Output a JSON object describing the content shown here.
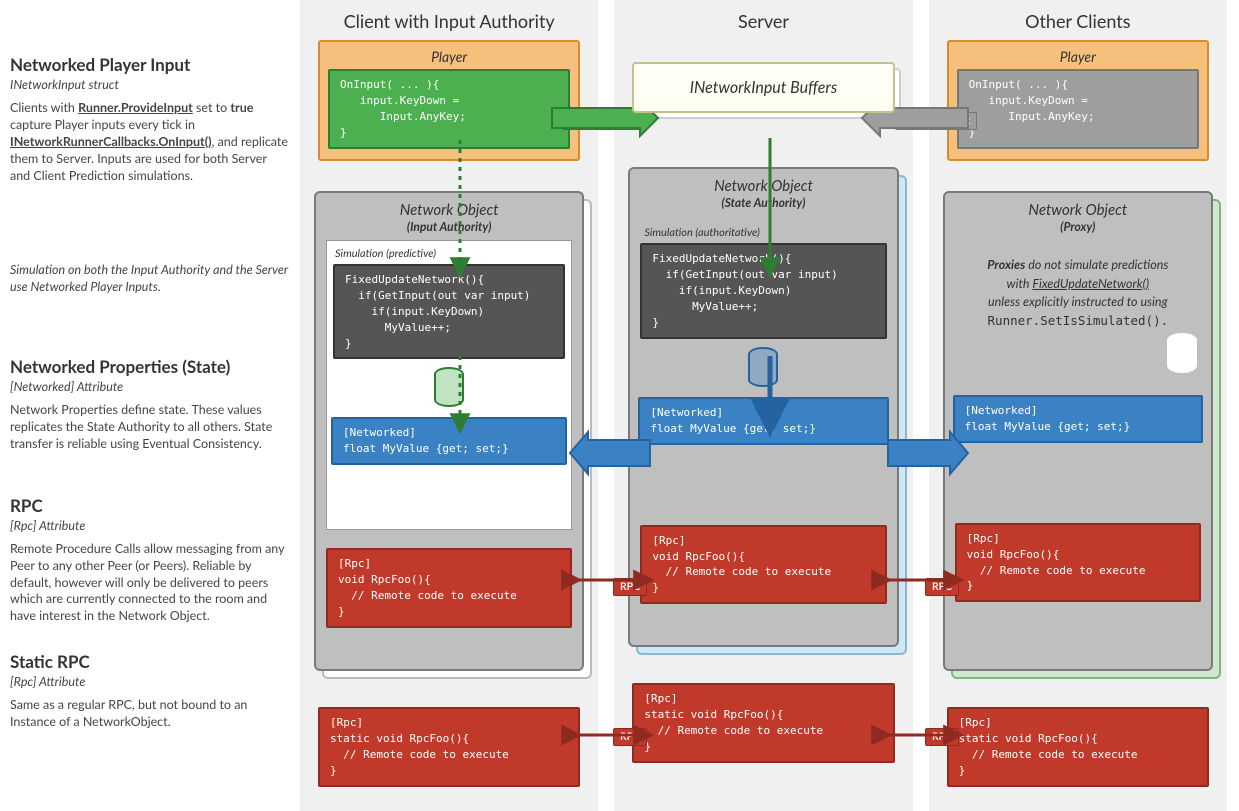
{
  "columns": {
    "client": "Client with Input Authority",
    "server": "Server",
    "other": "Other Clients"
  },
  "side": {
    "input": {
      "title": "Networked Player Input",
      "sub": "INetworkInput struct",
      "body_pre": "Clients with ",
      "body_b1": "Runner.ProvideInput",
      "body_mid1": " set to ",
      "body_b2": "true",
      "body_mid2": " capture Player inputs every tick in ",
      "body_b3": "INetworkRunnerCallbacks.OnInput()",
      "body_post": ", and replicate them to Server. Inputs are used for both Server and Client Prediction simulations."
    },
    "sim": "Simulation on both the Input Authority and the Server use Networked Player Inputs.",
    "state": {
      "title": "Networked Properties (State)",
      "sub": "[Networked] Attribute",
      "body": "Network Properties define state. These values replicates the State Authority to all others. State transfer is reliable using Eventual Consistency."
    },
    "rpc": {
      "title": "RPC",
      "sub": "[Rpc] Attribute",
      "body": "Remote Procedure Calls allow messaging from any Peer to any other Peer (or Peers). Reliable by default, however will only be delivered to peers which are currently connected to the room and have interest in  the Network Object."
    },
    "srpc": {
      "title": "Static RPC",
      "sub": "[Rpc] Attribute",
      "body": "Same as a regular RPC, but not bound to an Instance of a NetworkObject."
    }
  },
  "player_label": "Player",
  "code": {
    "oninput": "OnInput( ... ){\n   input.KeyDown =\n      Input.AnyKey;\n}",
    "fixed": "FixedUpdateNetwork(){\n  if(GetInput(out var input)\n    if(input.KeyDown)\n      MyValue++;\n}",
    "state": "[Networked]\nfloat MyValue {get; set;}",
    "rpc": "[Rpc]\nvoid RpcFoo(){\n  // Remote code to execute\n}",
    "srpc": "[Rpc]\nstatic void RpcFoo(){\n  // Remote code to execute\n}"
  },
  "buffers": "INetworkInput Buffers",
  "netobj": {
    "title": "Network Object",
    "client_sub": "(Input Authority)",
    "server_sub": "(State Authority)",
    "other_sub": "(Proxy)"
  },
  "sim_predictive": "Simulation (predictive)",
  "sim_auth": "Simulation (authoritative)",
  "proxy_note": {
    "l1_b": "Proxies",
    "l1": " do not simulate predictions",
    "l2_pre": "with ",
    "l2_i": "FixedUpdateNetwork()",
    "l3": "unless explicitly instructed to using",
    "l4": "Runner.SetIsSimulated()."
  },
  "labels": {
    "inetinput": "INetworkInput",
    "state": "State",
    "rpc": "RPC"
  }
}
